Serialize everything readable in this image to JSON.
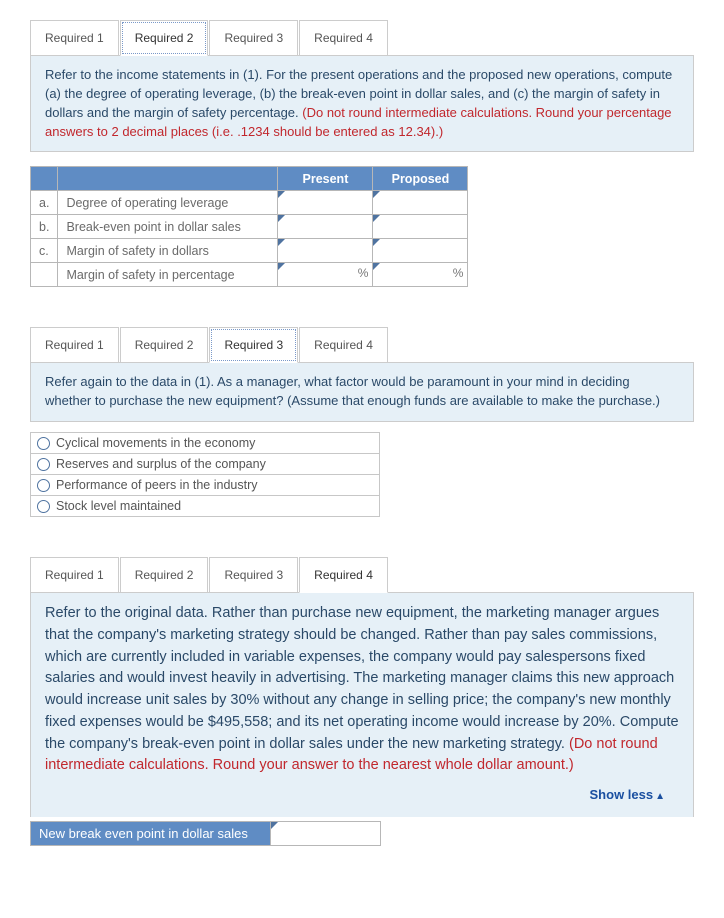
{
  "tabs": {
    "r1": "Required 1",
    "r2": "Required 2",
    "r3": "Required 3",
    "r4": "Required 4"
  },
  "sec2": {
    "prompt_main": "Refer to the income statements in (1). For the present operations and the proposed new operations, compute (a) the degree of operating leverage, (b) the break-even point in dollar sales, and (c) the margin of safety in dollars and the margin of safety percentage. ",
    "prompt_warn": "(Do not round intermediate calculations. Round your percentage answers to 2 decimal places (i.e. .1234 should be entered as 12.34).)",
    "col_present": "Present",
    "col_proposed": "Proposed",
    "rows": {
      "a": {
        "k": "a.",
        "t": "Degree of operating leverage"
      },
      "b": {
        "k": "b.",
        "t": "Break-even point in dollar sales"
      },
      "c": {
        "k": "c.",
        "t": "Margin of safety in dollars"
      },
      "d": {
        "k": "",
        "t": "Margin of safety in percentage"
      }
    },
    "pct": "%"
  },
  "sec3": {
    "prompt": "Refer again to the data in (1). As a manager, what factor would be paramount in your mind in deciding whether to purchase the new equipment? (Assume that enough funds are available to make the purchase.)",
    "opt1": "Cyclical movements in the economy",
    "opt2": "Reserves and surplus of the company",
    "opt3": "Performance of peers in the industry",
    "opt4": "Stock level maintained"
  },
  "sec4": {
    "prompt_main": "Refer to the original data. Rather than purchase new equipment, the marketing manager argues that the company's marketing strategy should be changed. Rather than pay sales commissions, which are currently included in variable expenses, the company would pay salespersons fixed salaries and would invest heavily in advertising. The marketing manager claims this new approach would increase unit sales by 30% without any change in selling price; the company's new monthly fixed expenses would be $495,558; and its net operating income would increase by 20%. Compute the company's break-even point in dollar sales under the new marketing strategy. ",
    "prompt_warn": "(Do not round intermediate calculations. Round your answer to the nearest whole dollar amount.)",
    "showless": "Show less",
    "rowlabel": "New break even point in dollar sales"
  }
}
